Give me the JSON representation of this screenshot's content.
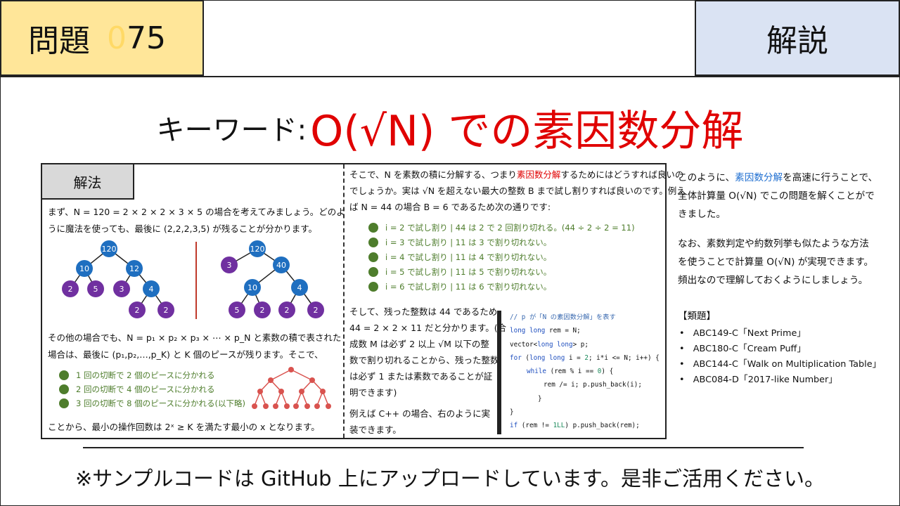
{
  "header": {
    "problem_label": "問題",
    "problem_number_faded": "0",
    "problem_number": "75",
    "kaisetsu_label": "解説"
  },
  "keyword": {
    "label": "キーワード:",
    "value": "O(√N) での素因数分解"
  },
  "method": {
    "label": "解法",
    "intro_line1": "まず、N = 120 = 2 × 2 × 2 × 3 × 5 の場合を考えてみましょう。どのよ",
    "intro_line2": "うに魔法を使っても、最後に (2,2,2,3,5) が残ることが分かります。",
    "general_line1": "その他の場合でも、N = p₁ × p₂ × p₃ × ⋯ × p_N と素数の積で表された",
    "general_line2": "場合は、最後に (p₁,p₂,…,p_K) と K 個のピースが残ります。そこで、",
    "cuts": [
      "1 回の切断で 2 個のピースに分かれる",
      "2 回の切断で 4 個のピースに分かれる",
      "3 回の切断で 8 個のピースに分かれる(以下略)"
    ],
    "conclusion": "ことから、最小の操作回数は 2ˣ ≥ K を満たす最小の x となります。"
  },
  "trees": {
    "tree1": [
      "120",
      "10",
      "12",
      "2",
      "5",
      "3",
      "4",
      "2",
      "2"
    ],
    "tree2": [
      "120",
      "3",
      "40",
      "10",
      "4",
      "5",
      "2",
      "2",
      "2"
    ]
  },
  "middle": {
    "para1_a": "そこで、N を素数の積に分解する、つまり",
    "para1_hl": "素因数分解",
    "para1_b": "するためにはどうすれば良いの",
    "para1_line2": "でしょうか。実は √N を超えない最大の整数 B まで試し割りすれば良いのです。例え",
    "para1_line3": "ば N = 44 の場合 B = 6 であるため次の通りです:",
    "trials": [
      "i = 2 で試し割り | 44 は 2 で 2 回割り切れる。(44 ÷ 2 ÷ 2 = 11)",
      "i = 3 で試し割り | 11 は 3 で割り切れない。",
      "i = 4 で試し割り | 11 は 4 で割り切れない。",
      "i = 5 で試し割り | 11 は 5 で割り切れない。",
      "i = 6 で試し割り | 11 は 6 で割り切れない。"
    ],
    "para2_lines": [
      "そして、残った整数は 44 であるため、",
      "44 = 2 × 2 × 11 だと分かります。(合",
      "成数 M は必ず 2 以上 √M 以下の整",
      "数で割り切れることから、残った整数",
      "は必ず 1 または素数であることが証",
      "明できます)"
    ],
    "para3_lines": [
      "例えば C++ の場合、右のように実",
      "装できます。"
    ]
  },
  "code": {
    "l1": "// p が「N の素因数分解」を表す",
    "l2_kw": "long long",
    "l2_rest": " rem = N;",
    "l3_a": "vector<",
    "l3_kw": "long long",
    "l3_b": "> p;",
    "l4_kw1": "for",
    "l4_a": " (",
    "l4_kw2": "long long",
    "l4_b": " i = ",
    "l4_n": "2",
    "l4_c": "; i*i <= N; i++) {",
    "l5_kw": "while",
    "l5_a": " (rem % i == ",
    "l5_n": "0",
    "l5_b": ") {",
    "l6": "rem /= i; p.push_back(i);",
    "l7": "}",
    "l8": "}",
    "l9_kw": "if",
    "l9_a": " (rem != ",
    "l9_n": "1LL",
    "l9_b": ") p.push_back(rem);"
  },
  "right": {
    "p1_a": "このように、",
    "p1_hl": "素因数分解",
    "p1_b": "を高速に行うことで、",
    "p1_line2": "全体計算量 O(√N) でこの問題を解くことがで",
    "p1_line3": "きました。",
    "p2_line1": "なお、素数判定や約数列挙も似たような方法",
    "p2_line2": "を使うことで計算量 O(√N) が実現できます。",
    "p2_line3": "頻出なので理解しておくようにしましょう。",
    "related_title": "【類題】",
    "related": [
      "ABC149-C「Next Prime」",
      "ABC180-C「Cream Puff」",
      "ABC144-C「Walk on Multiplication Table」",
      "ABC084-D「2017-like Number」"
    ]
  },
  "footer": "※サンプルコードは GitHub 上にアップロードしています。是非ご活用ください。",
  "colors": {
    "tree_blue": "#1f6fc0",
    "tree_purple": "#7030a0",
    "accent_red": "#e00000",
    "bullet_green": "#4e7d2c",
    "problem_bg": "#ffe699",
    "kaisetsu_bg": "#dae3f3"
  }
}
